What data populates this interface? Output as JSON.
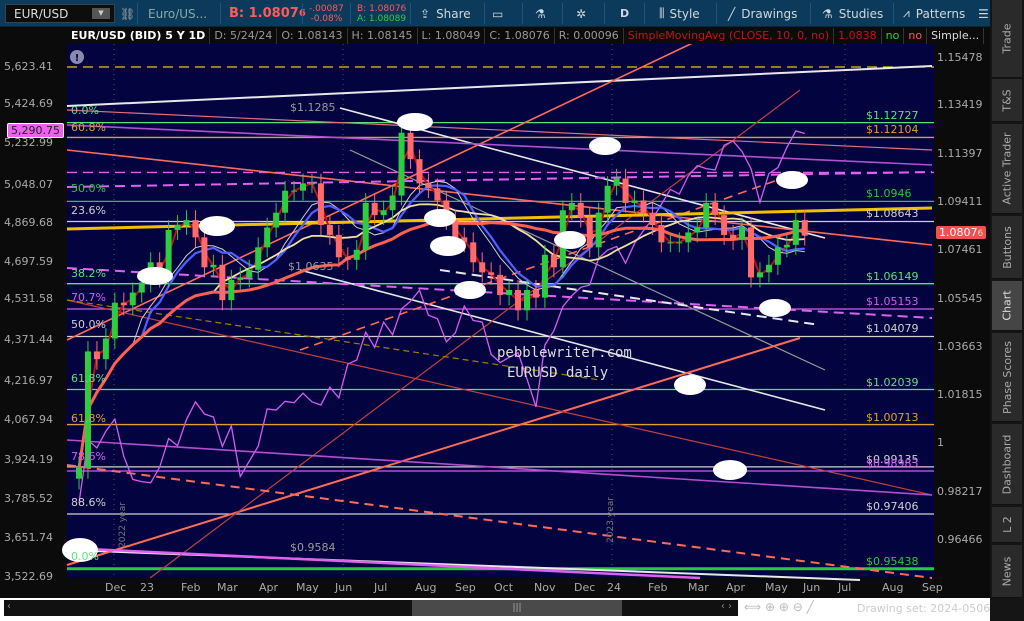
{
  "toolbar": {
    "symbol": "EUR/USD",
    "description": "Euro/US...",
    "bid_big": "B: 1.0807",
    "bid_big_small": "6",
    "change_abs": "-.00087",
    "change_pct": "-0.08%",
    "bid": "B: 1.08076",
    "ask": "A: 1.08089",
    "share": "Share",
    "period": "D",
    "style": "Style",
    "drawings": "Drawings",
    "studies": "Studies",
    "patterns": "Patterns"
  },
  "header": {
    "title": "EUR/USD (BID) 5 Y 1D",
    "date": "D: 5/24/24",
    "open": "O: 1.08143",
    "high": "H: 1.08145",
    "low": "L: 1.08049",
    "close": "C: 1.08076",
    "range": "R: 0.00096",
    "study": "SimpleMovingAvg (CLOSE, 10, 0, no)",
    "study_value": "1.0838",
    "flag1": "no",
    "flag2": "no",
    "study2": "Simple..."
  },
  "colors": {
    "chart_bg": "#03033f",
    "up": "#2ecc40",
    "down": "#ff6b6b",
    "spx": "#d65cf0",
    "accent_bid": "#ff5a5a"
  },
  "sidebar": {
    "tabs": [
      "Trade",
      "T&S",
      "Active Trader",
      "Buttons",
      "Chart",
      "Phase Scores",
      "Dashboard",
      "L 2",
      "News"
    ],
    "active": "Chart"
  },
  "footer": {
    "drawing_set": "Drawing set: 2024-0506"
  },
  "watermark": {
    "line1": "pebblewriter.com",
    "line2": "EURUSD daily"
  },
  "year_markers": [
    "2022 year",
    "2023 year"
  ],
  "annotations": [
    {
      "text": "$1.1285"
    },
    {
      "text": "$1.0635"
    },
    {
      "text": "$0.9584"
    }
  ],
  "price_tags": {
    "left": "5,290.75",
    "right": "1.0807",
    "right_small": "6"
  },
  "chart_data": {
    "type": "candlestick",
    "title": "EUR/USD (BID) 5 Y 1D",
    "x_ticks": [
      "Dec",
      "23",
      "Feb",
      "Mar",
      "Apr",
      "May",
      "Jun",
      "Jul",
      "Aug",
      "Sep",
      "Oct",
      "Nov",
      "Dec",
      "24",
      "Feb",
      "Mar",
      "Apr",
      "May",
      "Jun",
      "Jul",
      "Aug",
      "Sep"
    ],
    "right_axis_ticks": [
      "1.15478",
      "1.13419",
      "1.11397",
      "1.09411",
      "1.07461",
      "1.05545",
      "1.03663",
      "1.01815",
      "1",
      "0.98217",
      "0.96466"
    ],
    "left_axis_ticks": [
      "5,623.41",
      "5,424.69",
      "5,232.99",
      "5,048.07",
      "4,869.68",
      "4,697.59",
      "4,531.58",
      "4,371.44",
      "4,216.97",
      "4,067.94",
      "3,924.19",
      "3,785.52",
      "3,651.74",
      "3,522.69"
    ],
    "eurusd_weekly_close": [
      0.991,
      1.035,
      1.032,
      1.04,
      1.054,
      1.053,
      1.058,
      1.062,
      1.07,
      1.064,
      1.083,
      1.085,
      1.087,
      1.08,
      1.068,
      1.069,
      1.055,
      1.063,
      1.064,
      1.067,
      1.076,
      1.084,
      1.09,
      1.099,
      1.099,
      1.102,
      1.102,
      1.085,
      1.081,
      1.072,
      1.071,
      1.075,
      1.094,
      1.089,
      1.091,
      1.097,
      1.123,
      1.112,
      1.102,
      1.1,
      1.095,
      1.087,
      1.08,
      1.078,
      1.07,
      1.066,
      1.065,
      1.057,
      1.059,
      1.051,
      1.059,
      1.056,
      1.073,
      1.068,
      1.091,
      1.094,
      1.088,
      1.076,
      1.09,
      1.101,
      1.104,
      1.094,
      1.095,
      1.09,
      1.085,
      1.078,
      1.078,
      1.078,
      1.082,
      1.084,
      1.094,
      1.089,
      1.081,
      1.079,
      1.084,
      1.064,
      1.066,
      1.069,
      1.076,
      1.077,
      1.087,
      1.0807
    ],
    "spx_weekly_close": [
      3770,
      3993,
      3965,
      4026,
      4071,
      3934,
      3852,
      3844,
      3840,
      3895,
      3999,
      3973,
      4070,
      4136,
      4090,
      4079,
      3970,
      4046,
      3862,
      3917,
      3971,
      4109,
      4105,
      4138,
      4133,
      4169,
      4136,
      4124,
      4192,
      4151,
      4282,
      4298,
      4409,
      4348,
      4450,
      4399,
      4505,
      4536,
      4582,
      4478,
      4464,
      4370,
      4406,
      4516,
      4457,
      4450,
      4320,
      4288,
      4308,
      4327,
      4224,
      4117,
      4358,
      4415,
      4514,
      4559,
      4594,
      4604,
      4719,
      4754,
      4770,
      4697,
      4783,
      4840,
      4891,
      4958,
      5026,
      5005,
      5089,
      5137,
      5123,
      5117,
      5234,
      5254,
      5204,
      5123,
      4967,
      5100,
      5128,
      5223,
      5303,
      5290.75
    ],
    "levels": [
      {
        "price": 1.1509,
        "label": "",
        "color": "#e8c21a",
        "style": "dash"
      },
      {
        "price": 1.12727,
        "label": "$1.12727",
        "color": "#5ce27a",
        "style": "solid"
      },
      {
        "price": 1.12104,
        "label": "$1.12104",
        "color": "#e0a030",
        "style": "solid"
      },
      {
        "price": 1.1065,
        "label": "",
        "color": "#e060f0",
        "style": "dash"
      },
      {
        "price": 1.0946,
        "label": "$1.0946",
        "color": "#27c93f",
        "style": "solid"
      },
      {
        "price": 1.08643,
        "label": "$1.08643",
        "color": "#d0d0d0",
        "style": "solid"
      },
      {
        "price": 1.06149,
        "label": "$1.06149",
        "color": "#5ce27a",
        "style": "solid"
      },
      {
        "price": 1.05153,
        "label": "$1.05153",
        "color": "#d65cf0",
        "style": "solid"
      },
      {
        "price": 1.04079,
        "label": "$1.04079",
        "color": "#d0d0d0",
        "style": "solid"
      },
      {
        "price": 1.02039,
        "label": "$1.02039",
        "color": "#5ce27a",
        "style": "solid"
      },
      {
        "price": 1.00713,
        "label": "$1.00713",
        "color": "#e0a030",
        "style": "solid"
      },
      {
        "price": 0.99135,
        "label": "$0.99135",
        "color": "#d0d0d0",
        "style": "solid"
      },
      {
        "price": 0.98983,
        "label": "$0.98983",
        "color": "#d65cf0",
        "style": "solid"
      },
      {
        "price": 0.97406,
        "label": "$0.97406",
        "color": "#d0d0d0",
        "style": "solid"
      },
      {
        "price": 0.95438,
        "label": "$0.95438",
        "color": "#27c93f",
        "style": "thick"
      }
    ],
    "fib_labels": [
      {
        "text": "0.0%",
        "color": "#5ce27a"
      },
      {
        "text": "60.8%",
        "color": "#e0a030"
      },
      {
        "text": "50.0%",
        "color": "#27c93f"
      },
      {
        "text": "23.6%",
        "color": "#d0d0d0"
      },
      {
        "text": "38.2%",
        "color": "#5ce27a"
      },
      {
        "text": "70.7%",
        "color": "#d65cf0"
      },
      {
        "text": "50.0%",
        "color": "#d0d0d0"
      },
      {
        "text": "61.8%",
        "color": "#5ce27a"
      },
      {
        "text": "61.8%",
        "color": "#e0a030"
      },
      {
        "text": "78.6%",
        "color": "#d65cf0"
      },
      {
        "text": "88.6%",
        "color": "#d0d0d0"
      },
      {
        "text": "0.0%",
        "color": "#5ce27a"
      }
    ]
  }
}
